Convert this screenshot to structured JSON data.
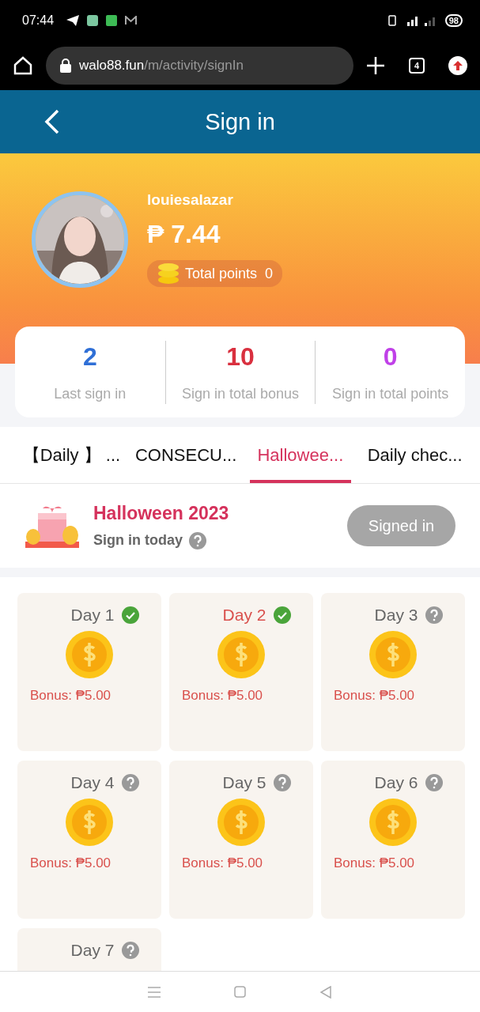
{
  "status_bar": {
    "time": "07:44",
    "battery": "98"
  },
  "browser": {
    "url_host": "walo88.fun",
    "url_path": "/m/activity/signIn",
    "tab_count": "4"
  },
  "header": {
    "title": "Sign in"
  },
  "profile": {
    "username": "louiesalazar",
    "balance": "₱ 7.44",
    "points_label": "Total points",
    "points_value": "0"
  },
  "stats": [
    {
      "value": "2",
      "label": "Last sign in",
      "color": "#2f6fd6"
    },
    {
      "value": "10",
      "label": "Sign in total bonus",
      "color": "#d9303f"
    },
    {
      "value": "0",
      "label": "Sign in total points",
      "color": "#c040e8"
    }
  ],
  "tabs": [
    {
      "label": "【Daily 】 ...",
      "selected": false
    },
    {
      "label": "CONSECU...",
      "selected": false
    },
    {
      "label": "Hallowee...",
      "selected": true
    },
    {
      "label": "Daily chec...",
      "selected": false
    }
  ],
  "event": {
    "title": "Halloween 2023",
    "subtitle": "Sign in today",
    "button": "Signed in",
    "button_disabled": true
  },
  "days": [
    {
      "label": "Day 1",
      "signed": true,
      "today": false,
      "bonus": "Bonus: ₱5.00"
    },
    {
      "label": "Day 2",
      "signed": true,
      "today": true,
      "bonus": "Bonus: ₱5.00"
    },
    {
      "label": "Day 3",
      "signed": false,
      "today": false,
      "bonus": "Bonus: ₱5.00"
    },
    {
      "label": "Day 4",
      "signed": false,
      "today": false,
      "bonus": "Bonus: ₱5.00"
    },
    {
      "label": "Day 5",
      "signed": false,
      "today": false,
      "bonus": "Bonus: ₱5.00"
    },
    {
      "label": "Day 6",
      "signed": false,
      "today": false,
      "bonus": "Bonus: ₱5.00"
    },
    {
      "label": "Day 7",
      "signed": false,
      "today": false
    }
  ]
}
